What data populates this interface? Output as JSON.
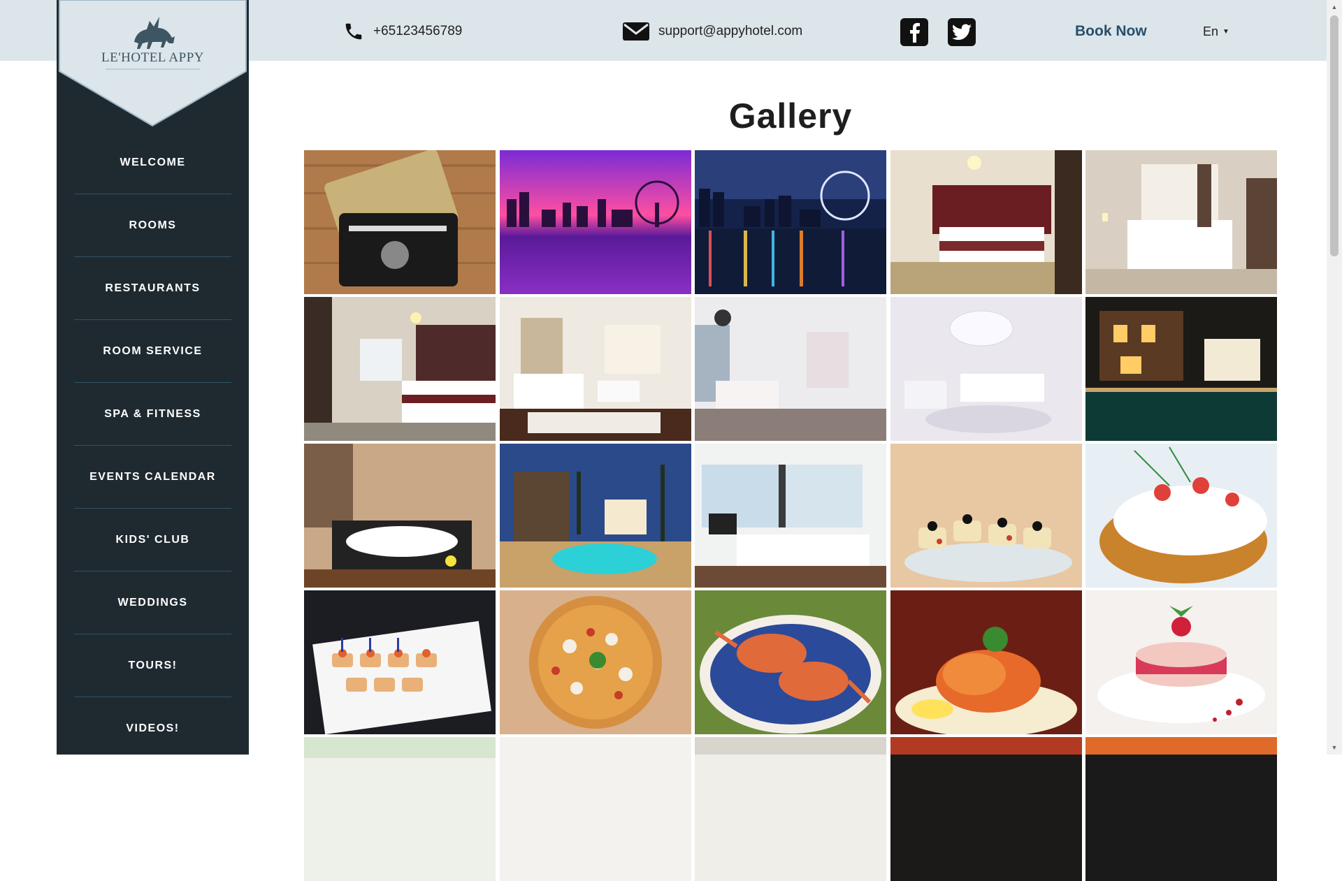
{
  "header": {
    "phone": "+65123456789",
    "email": "support@appyhotel.com",
    "book_now": "Book Now",
    "language": "En",
    "social": [
      "facebook-icon",
      "twitter-icon"
    ],
    "background_color": "#dce5ea"
  },
  "brand": {
    "name": "LE'HOTEL APPY"
  },
  "sidebar": {
    "items": [
      {
        "label": "WELCOME"
      },
      {
        "label": "ROOMS"
      },
      {
        "label": "RESTAURANTS"
      },
      {
        "label": "ROOM SERVICE"
      },
      {
        "label": "SPA & FITNESS"
      },
      {
        "label": "EVENTS CALENDAR"
      },
      {
        "label": "KIDS' CLUB"
      },
      {
        "label": "WEDDINGS"
      },
      {
        "label": "TOURS!"
      },
      {
        "label": "VIDEOS!"
      }
    ],
    "background_color": "#1f2a30"
  },
  "main": {
    "title": "Gallery"
  },
  "gallery": {
    "photos": [
      {
        "subject": "credit-cards"
      },
      {
        "subject": "city-skyline-sunset"
      },
      {
        "subject": "city-skyline-night"
      },
      {
        "subject": "hotel-room-red-headboard"
      },
      {
        "subject": "hotel-room-white"
      },
      {
        "subject": "twin-bed-room"
      },
      {
        "subject": "suite-living-area"
      },
      {
        "subject": "suite-open-plan"
      },
      {
        "subject": "white-suite-chandelier"
      },
      {
        "subject": "villa-pool-night"
      },
      {
        "subject": "jacuzzi-bathroom"
      },
      {
        "subject": "villa-pool-dusk"
      },
      {
        "subject": "sea-view-bedroom"
      },
      {
        "subject": "canapes-olives"
      },
      {
        "subject": "cheese-tomato-bread"
      },
      {
        "subject": "salmon-canapes"
      },
      {
        "subject": "seafood-pizza"
      },
      {
        "subject": "blue-crabs"
      },
      {
        "subject": "prawns-dish"
      },
      {
        "subject": "raspberry-macaron"
      },
      {
        "subject": "partial-1"
      },
      {
        "subject": "partial-2"
      },
      {
        "subject": "partial-3"
      },
      {
        "subject": "partial-4"
      },
      {
        "subject": "partial-5"
      }
    ]
  }
}
